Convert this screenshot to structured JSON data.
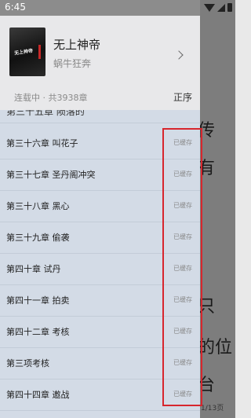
{
  "status_bar": {
    "time": "6:45"
  },
  "book": {
    "title": "无上神帝",
    "author": "蜗牛狂奔",
    "cover_text": "无上神帝",
    "status_line": "连载中 · 共3938章",
    "order_label": "正序"
  },
  "chapters": {
    "partial_top": "第三十五章 陨落的",
    "items": [
      {
        "title": "第三十六章 叫花子",
        "state": "已缓存"
      },
      {
        "title": "第三十七章 圣丹阁冲突",
        "state": "已缓存"
      },
      {
        "title": "第三十八章 黑心",
        "state": "已缓存"
      },
      {
        "title": "第三十九章 偷袭",
        "state": "已缓存"
      },
      {
        "title": "第四十章 试丹",
        "state": "已缓存"
      },
      {
        "title": "第四十一章 拍卖",
        "state": "已缓存"
      },
      {
        "title": "第四十二章 考核",
        "state": "已缓存"
      },
      {
        "title": "第三项考核",
        "state": "已缓存"
      },
      {
        "title": "第四十四章 邀战",
        "state": "已缓存"
      }
    ]
  },
  "reader_background": {
    "glyphs": [
      "传",
      "有",
      "只",
      "的位",
      "台"
    ],
    "page_indicator": "1/13页"
  },
  "colors": {
    "highlight": "#d7262d",
    "list_background": "#d3dbe6"
  }
}
